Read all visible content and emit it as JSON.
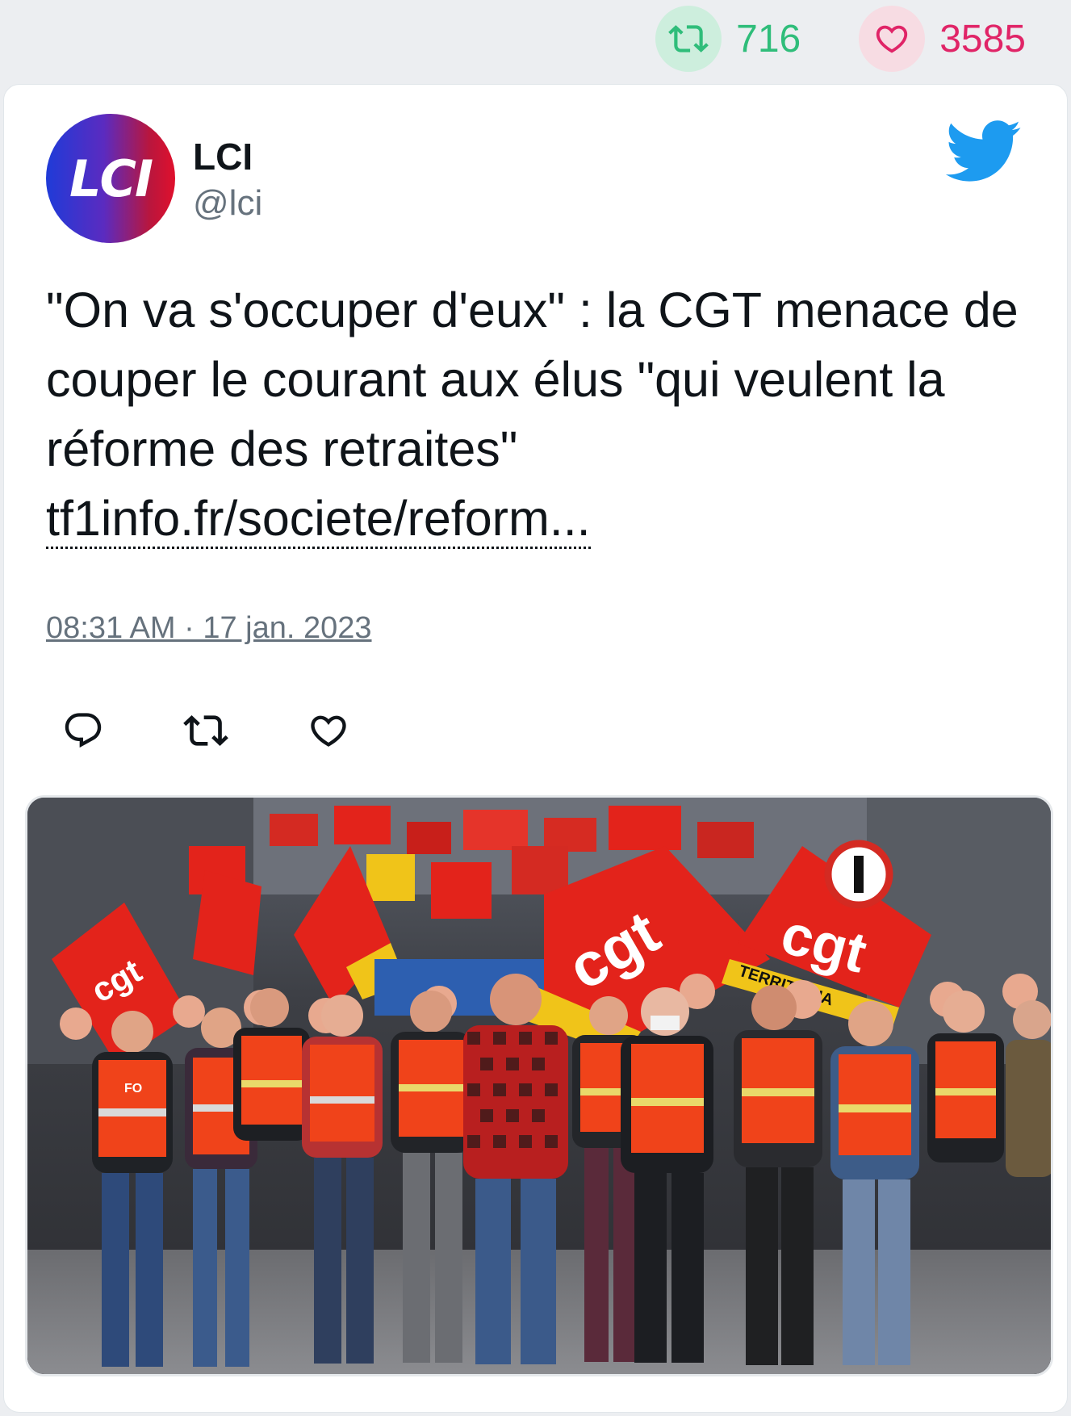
{
  "engagement": {
    "retweets": "716",
    "likes": "3585"
  },
  "author": {
    "avatar_text": "LCI",
    "name": "LCI",
    "handle": "@lci"
  },
  "tweet": {
    "text": "\"On va s'occuper d'eux\" : la CGT menace de couper le courant aux élus \"qui veulent la réforme des retraites\"",
    "link": "tf1info.fr/societe/reform...",
    "timestamp": "08:31 AM · 17 jan. 2023"
  },
  "media": {
    "signs": [
      "cgt",
      "cgt",
      "TERRITORIA",
      "FO"
    ]
  },
  "colors": {
    "retweet": "#2fbd7a",
    "like": "#e02467",
    "twitter_blue": "#1d9bf0",
    "vest_orange": "#f0431a",
    "flag_red": "#e3231b"
  },
  "icons": [
    "retweet-icon",
    "heart-icon",
    "twitter-bird-icon",
    "reply-icon"
  ]
}
